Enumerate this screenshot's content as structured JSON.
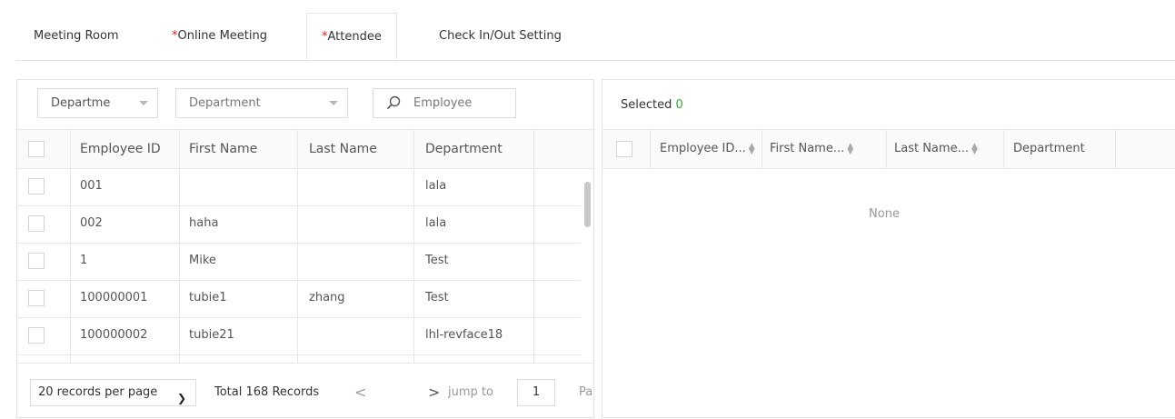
{
  "tabs": [
    {
      "label": "Meeting Room",
      "required": false
    },
    {
      "label": "Online Meeting",
      "required": true
    },
    {
      "label": "Attendee",
      "required": true,
      "active": true
    },
    {
      "label": "Check In/Out Setting",
      "required": false
    }
  ],
  "required_mark": "*",
  "left": {
    "filters": {
      "department_short": "Departme",
      "department": "Department",
      "employee_placeholder": "Employee"
    },
    "columns": [
      "Employee ID",
      "First Name",
      "Last Name",
      "Department"
    ],
    "rows": [
      {
        "id": "001",
        "first": "",
        "last": "",
        "dept": "lala"
      },
      {
        "id": "002",
        "first": "haha",
        "last": "",
        "dept": "lala"
      },
      {
        "id": "1",
        "first": "Mike",
        "last": "",
        "dept": "Test"
      },
      {
        "id": "100000001",
        "first": "tubie1",
        "last": "zhang",
        "dept": "Test"
      },
      {
        "id": "100000002",
        "first": "tubie21",
        "last": "",
        "dept": "lhl-revface18"
      }
    ],
    "pager": {
      "per_page": "20 records per page",
      "total": "Total 168 Records",
      "prev": "<",
      "next": ">",
      "jump_to": "jump to",
      "page": "1",
      "page_suffix": "Pa"
    }
  },
  "right": {
    "selected_label": "Selected",
    "selected_count": "0",
    "columns": [
      "Employee ID...",
      "First Name...",
      "Last Name...",
      "Department"
    ],
    "empty_text": "None"
  },
  "colors": {
    "required": "#e02020",
    "count": "#3aa53a",
    "border": "#e3e3e3"
  },
  "icons": {
    "search": "search-icon",
    "caret": "caret-down-icon",
    "chevron": "chevron-down-icon",
    "sort": "sort-icon"
  }
}
